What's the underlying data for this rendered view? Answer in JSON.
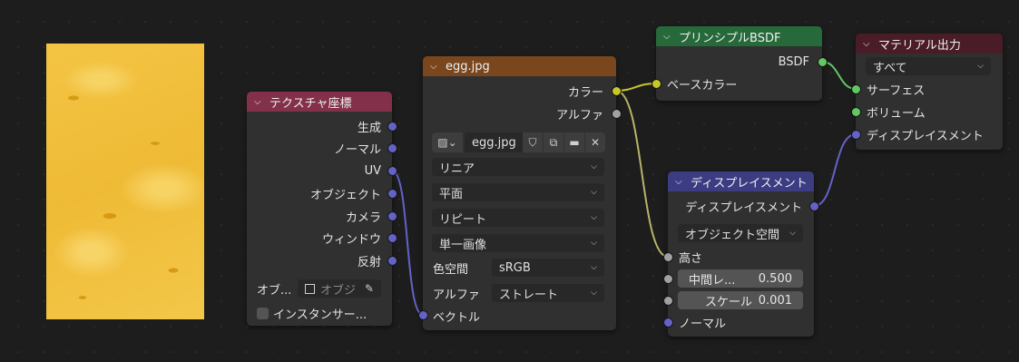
{
  "texture_coord": {
    "title": "テクスチャ座標",
    "outputs": [
      "生成",
      "ノーマル",
      "UV",
      "オブジェクト",
      "カメラ",
      "ウィンドウ",
      "反射"
    ],
    "object_label": "オブ...",
    "object_placeholder": "オブジ",
    "instancer_label": "インスタンサー..."
  },
  "image_node": {
    "title": "egg.jpg",
    "outputs": [
      "カラー",
      "アルファ"
    ],
    "image_name": "egg.jpg",
    "interpolation": "リニア",
    "projection": "平面",
    "extension": "リピート",
    "source": "単一画像",
    "colorspace_label": "色空間",
    "colorspace": "sRGB",
    "alpha_label": "アルファ",
    "alpha_mode": "ストレート",
    "input": "ベクトル"
  },
  "bsdf": {
    "title": "プリンシプルBSDF",
    "output": "BSDF",
    "input": "ベースカラー"
  },
  "output_node": {
    "title": "マテリアル出力",
    "target": "すべて",
    "inputs": [
      "サーフェス",
      "ボリューム",
      "ディスプレイスメント"
    ]
  },
  "displacement": {
    "title": "ディスプレイスメント",
    "output": "ディスプレイスメント",
    "space": "オブジェクト空間",
    "height_label": "高さ",
    "midlevel_label": "中間レ...",
    "midlevel_value": "0.500",
    "scale_label": "スケール",
    "scale_value": "0.001",
    "normal_label": "ノーマル"
  },
  "colors": {
    "header_texture": "#83314a",
    "header_image": "#79461d",
    "header_shader": "#26693a",
    "header_output": "#4a1c27",
    "header_vector": "#3c3c83",
    "socket_color": "#c7c729",
    "socket_float": "#a1a1a1",
    "socket_vector": "#6363c7",
    "socket_shader": "#63c763"
  }
}
